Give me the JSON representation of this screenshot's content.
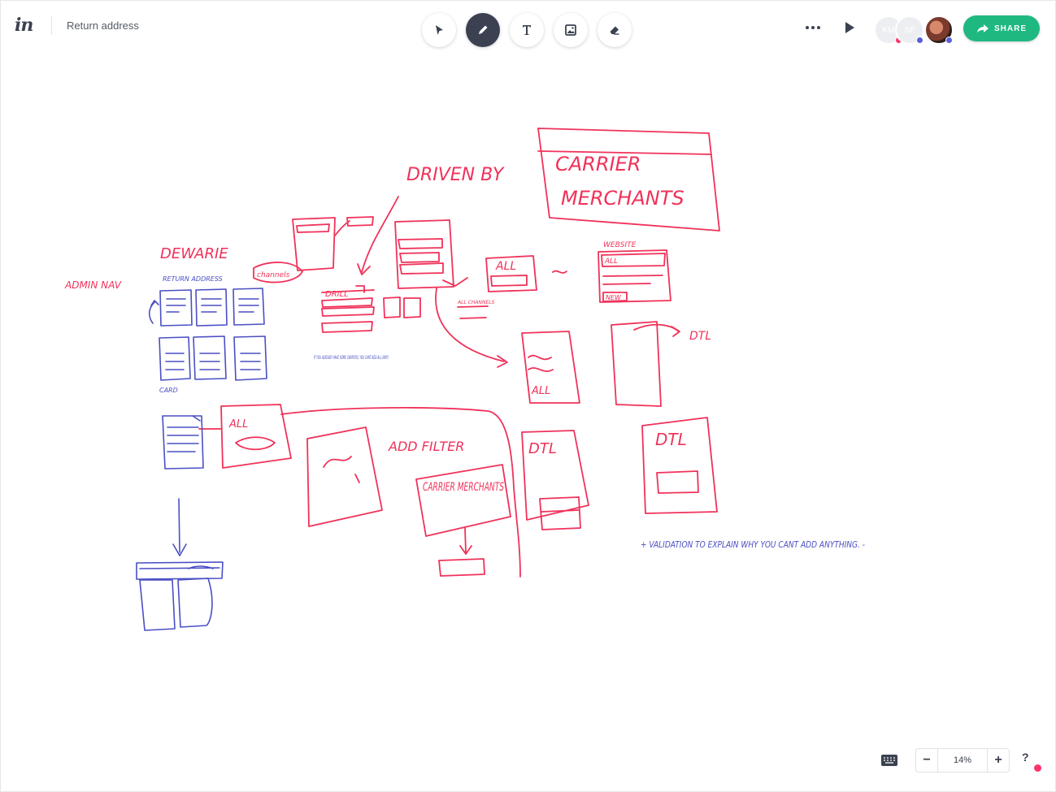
{
  "app": {
    "logo": "in",
    "doc_title": "Return address"
  },
  "toolbar": {
    "tools": [
      {
        "name": "select",
        "icon": "cursor-icon",
        "active": false
      },
      {
        "name": "pen",
        "icon": "pen-icon",
        "active": true
      },
      {
        "name": "text",
        "icon": "text-icon",
        "active": false
      },
      {
        "name": "image",
        "icon": "image-icon",
        "active": false
      },
      {
        "name": "eraser",
        "icon": "eraser-icon",
        "active": false
      }
    ]
  },
  "header_right": {
    "avatars": [
      {
        "initials": "KM",
        "dot_color": "#ff3366"
      },
      {
        "initials": "SP",
        "dot_color": "#5b5fd8"
      },
      {
        "initials": "",
        "dot_color": "#5b5fd8"
      }
    ],
    "share_label": "SHARE"
  },
  "sketch_labels": {
    "driven_by": "DRIVEN BY",
    "carrier": "CARRIER",
    "merchants": "MERCHANTS",
    "dewarie": "DEWARIE",
    "admin_nav": "ADMIN NAV",
    "return_address": "RETURN ADDRESS",
    "card": "CARD",
    "channels": "channels",
    "all": "ALL",
    "new": "NEW",
    "website": "WEBSITE",
    "drill": "DRILL",
    "all_channels": "ALL CHANNELS",
    "carrier_merchants_2": "CARRIER MERCHANTS",
    "add_filter": "ADD FILTER",
    "dtl": "DTL",
    "validation": "+ VALIDATION TO EXPLAIN WHY YOU CANT ADD ANYTHING. -",
    "note": "IF YOU ALREADY HAVE SOME CARRIERS, YOU CANT ADD ALL (ANY)"
  },
  "footer": {
    "zoom": "14%",
    "help": "?"
  },
  "colors": {
    "pink": "#f0325a",
    "blue": "#4a4fc4",
    "accent": "#1fb881",
    "dark": "#3b4150"
  }
}
